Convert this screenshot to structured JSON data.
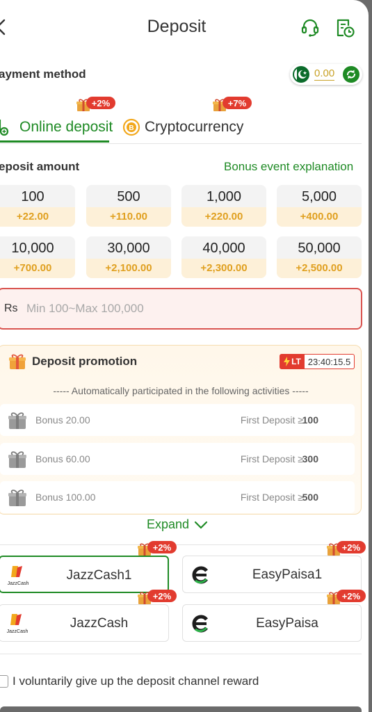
{
  "header": {
    "title": "Deposit"
  },
  "payment_method": {
    "label": "ayment method",
    "balance": "0.00"
  },
  "tabs": [
    {
      "label": "Online deposit",
      "badge": "+2%",
      "active": true
    },
    {
      "label": "Cryptocurrency",
      "badge": "+7%",
      "active": false
    }
  ],
  "deposit_amount": {
    "label": "eposit amount",
    "bonus_link": "Bonus event explanation",
    "options": [
      {
        "amount": "100",
        "bonus": "+22.00"
      },
      {
        "amount": "500",
        "bonus": "+110.00"
      },
      {
        "amount": "1,000",
        "bonus": "+220.00"
      },
      {
        "amount": "5,000",
        "bonus": "+400.00"
      },
      {
        "amount": "10,000",
        "bonus": "+700.00"
      },
      {
        "amount": "30,000",
        "bonus": "+2,100.00"
      },
      {
        "amount": "40,000",
        "bonus": "+2,300.00"
      },
      {
        "amount": "50,000",
        "bonus": "+2,500.00"
      }
    ]
  },
  "amount_input": {
    "currency": "Rs",
    "placeholder": "Min 100~Max 100,000",
    "value": ""
  },
  "promotion": {
    "title": "Deposit promotion",
    "timer_tag": "LT",
    "timer": "23:40:15.5",
    "auto_text": "----- Automatically participated in the following activities -----",
    "items": [
      {
        "bonus": "Bonus 20.00",
        "condition": "First Deposit ≥",
        "threshold": "100"
      },
      {
        "bonus": "Bonus 60.00",
        "condition": "First Deposit ≥",
        "threshold": "300"
      },
      {
        "bonus": "Bonus 100.00",
        "condition": "First Deposit ≥",
        "threshold": "500"
      }
    ],
    "expand_label": "Expand"
  },
  "channels": [
    {
      "name": "JazzCash1",
      "badge": "+2%",
      "logo": "jazzcash-logo",
      "logo_text": "JazzCash",
      "selected": true
    },
    {
      "name": "EasyPaisa1",
      "badge": "+2%",
      "logo": "easypaisa-logo",
      "selected": false
    },
    {
      "name": "JazzCash",
      "badge": "+2%",
      "logo": "jazzcash-logo",
      "logo_text": "JazzCash",
      "selected": false
    },
    {
      "name": "EasyPaisa",
      "badge": "+2%",
      "logo": "easypaisa-logo",
      "selected": false
    }
  ],
  "give_up": {
    "label": "I voluntarily give up the deposit channel reward",
    "checked": false
  },
  "colors": {
    "accent_green": "#1e8a24",
    "badge_red": "#e23b2f",
    "bonus_orange": "#e0a020",
    "balance_gold": "#c9a227"
  }
}
